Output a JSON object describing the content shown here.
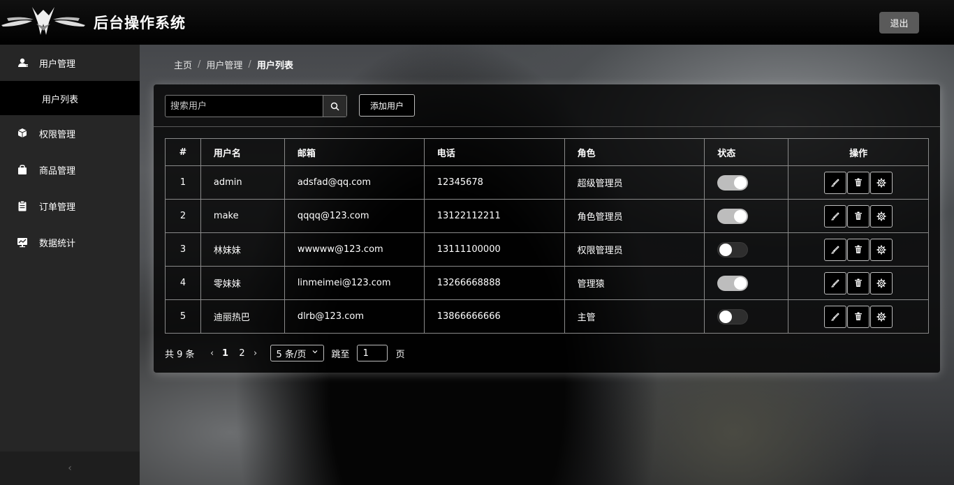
{
  "header": {
    "title": "后台操作系统",
    "logout_label": "退出"
  },
  "sidebar": {
    "items": [
      {
        "label": "用户管理",
        "icon": "user-icon"
      },
      {
        "label": "权限管理",
        "icon": "cube-icon"
      },
      {
        "label": "商品管理",
        "icon": "bag-icon"
      },
      {
        "label": "订单管理",
        "icon": "clipboard-icon"
      },
      {
        "label": "数据统计",
        "icon": "chart-monitor-icon"
      }
    ],
    "active_sub": "用户列表",
    "collapse_glyph": "‹"
  },
  "breadcrumb": [
    "主页",
    "用户管理",
    "用户列表"
  ],
  "toolbar": {
    "search_placeholder": "搜索用户",
    "add_label": "添加用户"
  },
  "table": {
    "columns": [
      "#",
      "用户名",
      "邮箱",
      "电话",
      "角色",
      "状态",
      "操作"
    ],
    "rows": [
      {
        "idx": "1",
        "name": "admin",
        "email": "adsfad@qq.com",
        "phone": "12345678",
        "role": "超级管理员",
        "state": true
      },
      {
        "idx": "2",
        "name": "make",
        "email": "qqqq@123.com",
        "phone": "13122112211",
        "role": "角色管理员",
        "state": true
      },
      {
        "idx": "3",
        "name": "林妹妹",
        "email": "wwwww@123.com",
        "phone": "13111100000",
        "role": "权限管理员",
        "state": false
      },
      {
        "idx": "4",
        "name": "零妹妹",
        "email": "linmeimei@123.com",
        "phone": "13266668888",
        "role": "管理猿",
        "state": true
      },
      {
        "idx": "5",
        "name": "迪丽热巴",
        "email": "dlrb@123.com",
        "phone": "13866666666",
        "role": "主管",
        "state": false
      }
    ]
  },
  "pagination": {
    "total": "共 9 条",
    "pages": [
      "1",
      "2"
    ],
    "current": "1",
    "page_size": "5 条/页",
    "jump_label": "跳至",
    "jump_value": "1",
    "page_suffix": "页"
  }
}
